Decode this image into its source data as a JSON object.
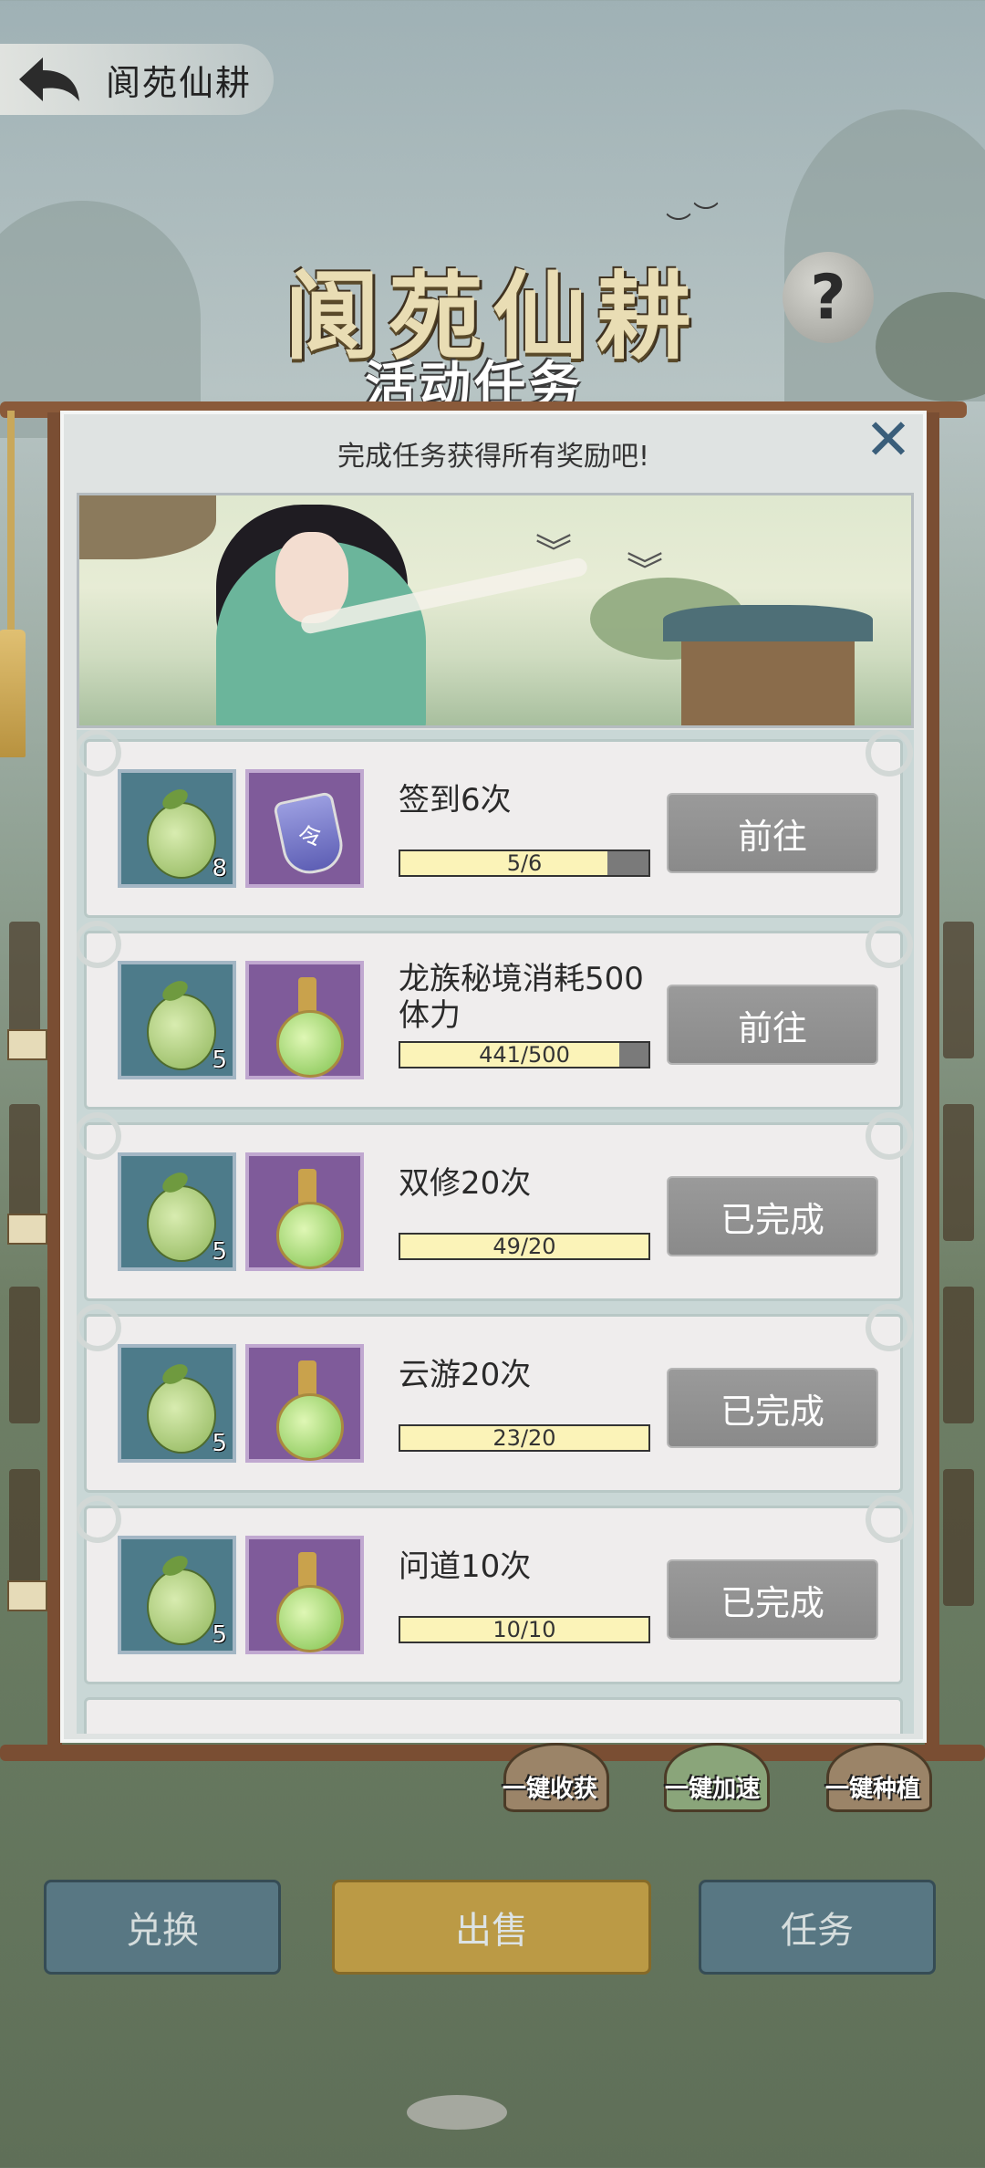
{
  "header": {
    "title": "阆苑仙耕"
  },
  "event": {
    "title": "阆苑仙耕",
    "subtitle": "活动任务",
    "help_label": "?"
  },
  "modal": {
    "header": "完成任务获得所有奖励吧!",
    "close_label": "✕",
    "tasks": [
      {
        "name": "签到6次",
        "reward1_count": "8",
        "reward2": "token-icon",
        "progress_text": "5/6",
        "progress": 0.833,
        "button": "前往"
      },
      {
        "name": "龙族秘境消耗500体力",
        "reward1_count": "5",
        "reward2": "potion-icon",
        "progress_text": "441/500",
        "progress": 0.882,
        "button": "前往"
      },
      {
        "name": "双修20次",
        "reward1_count": "5",
        "reward2": "potion-icon",
        "progress_text": "49/20",
        "progress": 1,
        "button": "已完成"
      },
      {
        "name": "云游20次",
        "reward1_count": "5",
        "reward2": "potion-icon",
        "progress_text": "23/20",
        "progress": 1,
        "button": "已完成"
      },
      {
        "name": "问道10次",
        "reward1_count": "5",
        "reward2": "potion-icon",
        "progress_text": "10/10",
        "progress": 1,
        "button": "已完成"
      }
    ]
  },
  "shortcuts": [
    "一键收获",
    "一键加速",
    "一键种植"
  ],
  "bottom_buttons": [
    "兑换",
    "出售",
    "任务"
  ],
  "colors": {
    "progress_fill": "#fbf3b8",
    "button_gray": "#8f8f8f",
    "gold": "#c59f43",
    "blue": "#57788a"
  }
}
